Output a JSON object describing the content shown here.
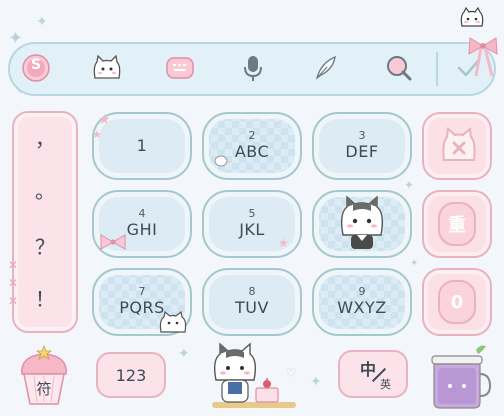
{
  "toolbar": {
    "icons": [
      "logo-s-icon",
      "cat-face-icon",
      "keyboard-icon",
      "microphone-icon",
      "feather-pen-icon",
      "search-icon"
    ],
    "logo_letter": "S",
    "confirm_icon": "check-icon"
  },
  "punctuation": {
    "items": [
      "，",
      "。",
      "？",
      "！"
    ]
  },
  "keys": [
    {
      "num": "",
      "letters": "1"
    },
    {
      "num": "2",
      "letters": "ABC"
    },
    {
      "num": "3",
      "letters": "DEF"
    },
    {
      "num": "4",
      "letters": "GHI"
    },
    {
      "num": "5",
      "letters": "JKL"
    },
    {
      "num": "",
      "letters": ""
    },
    {
      "num": "7",
      "letters": "PQRS"
    },
    {
      "num": "8",
      "letters": "TUV"
    },
    {
      "num": "9",
      "letters": "WXYZ"
    }
  ],
  "side": {
    "delete_icon": "cat-delete-icon",
    "retype_label": "重",
    "zero_label": "0"
  },
  "bottom": {
    "symbol_label": "符",
    "num_label": "123",
    "lang_main": "中",
    "lang_sub": "英"
  },
  "colors": {
    "accent": "#a7c7cf",
    "pink": "#fbe1e7",
    "key_bg": "#dcebf4",
    "text": "#3d4b57"
  }
}
